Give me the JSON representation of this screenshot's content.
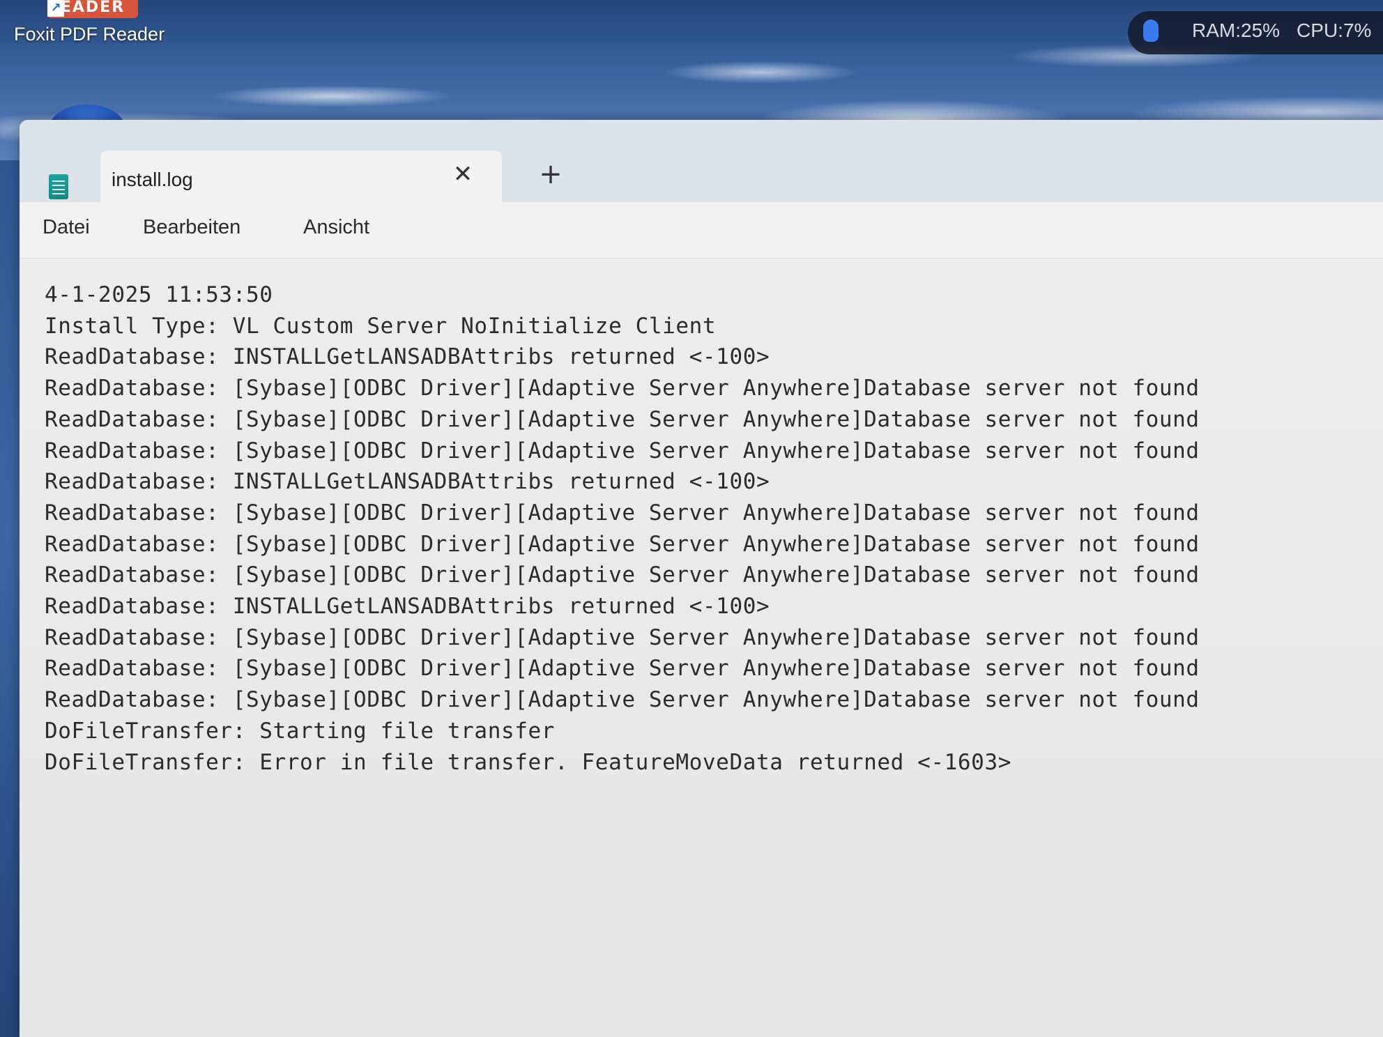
{
  "desktop": {
    "shortcut": {
      "badge_text": "EADER",
      "label": "Foxit PDF Reader"
    },
    "system_monitor": {
      "ram": "RAM:25%",
      "cpu": "CPU:7%"
    }
  },
  "window": {
    "app_icon": "notepad-icon",
    "tab": {
      "title": "install.log",
      "close_glyph": "✕"
    },
    "new_tab_glyph": "+",
    "menu": {
      "file": "Datei",
      "edit": "Bearbeiten",
      "view": "Ansicht"
    },
    "editor": {
      "lines": [
        "4-1-2025 11:53:50",
        "Install Type: VL Custom Server NoInitialize Client",
        "ReadDatabase: INSTALLGetLANSADBAttribs returned <-100>",
        "ReadDatabase: [Sybase][ODBC Driver][Adaptive Server Anywhere]Database server not found",
        "ReadDatabase: [Sybase][ODBC Driver][Adaptive Server Anywhere]Database server not found",
        "ReadDatabase: [Sybase][ODBC Driver][Adaptive Server Anywhere]Database server not found",
        "ReadDatabase: INSTALLGetLANSADBAttribs returned <-100>",
        "ReadDatabase: [Sybase][ODBC Driver][Adaptive Server Anywhere]Database server not found",
        "ReadDatabase: [Sybase][ODBC Driver][Adaptive Server Anywhere]Database server not found",
        "ReadDatabase: [Sybase][ODBC Driver][Adaptive Server Anywhere]Database server not found",
        "ReadDatabase: INSTALLGetLANSADBAttribs returned <-100>",
        "ReadDatabase: [Sybase][ODBC Driver][Adaptive Server Anywhere]Database server not found",
        "ReadDatabase: [Sybase][ODBC Driver][Adaptive Server Anywhere]Database server not found",
        "ReadDatabase: [Sybase][ODBC Driver][Adaptive Server Anywhere]Database server not found",
        "DoFileTransfer: Starting file transfer",
        "DoFileTransfer: Error in file transfer. FeatureMoveData returned <-1603>"
      ]
    }
  }
}
